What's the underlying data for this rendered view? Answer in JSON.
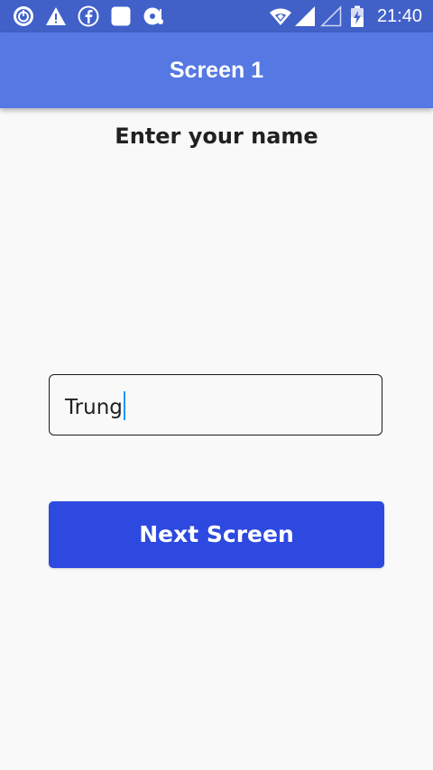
{
  "status_bar": {
    "time": "21:40",
    "background": "#4161c9",
    "icons": [
      "power-icon",
      "warning-icon",
      "facebook-icon",
      "square-app-icon",
      "media-icon",
      "wifi-icon",
      "signal-icon",
      "signal-empty-icon",
      "battery-charging-icon"
    ]
  },
  "app_bar": {
    "title": "Screen 1",
    "background": "#5578e3"
  },
  "main": {
    "heading": "Enter your name",
    "name_input": {
      "value": "Trung",
      "placeholder": ""
    },
    "next_button": {
      "label": "Next Screen",
      "background": "#2d49df"
    }
  }
}
